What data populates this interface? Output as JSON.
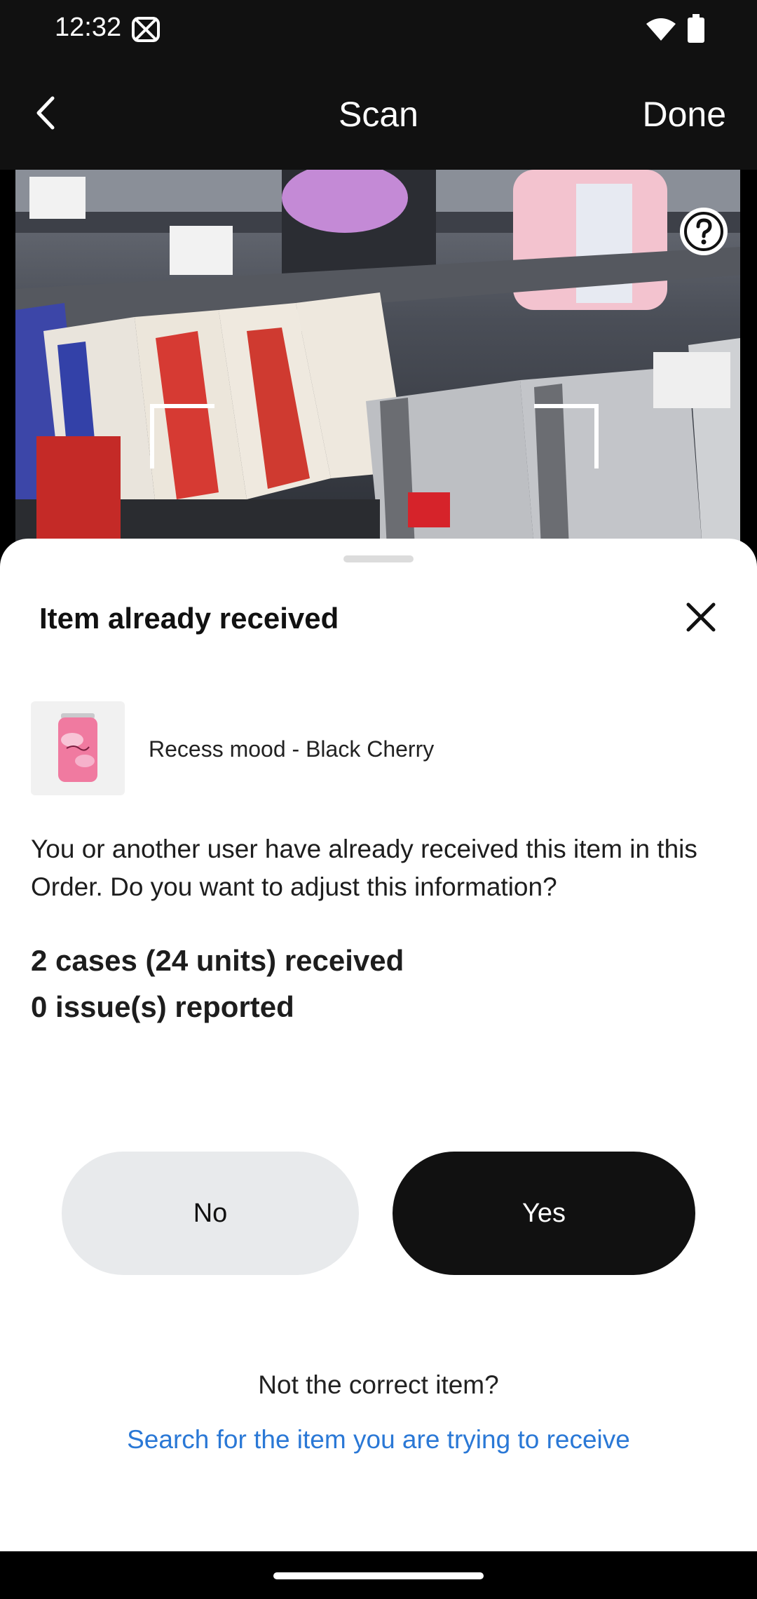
{
  "status_bar": {
    "time": "12:32",
    "icons": [
      "app-notification-icon",
      "wifi-icon",
      "battery-icon"
    ]
  },
  "app_bar": {
    "back_icon": "chevron-left-icon",
    "title": "Scan",
    "done_label": "Done"
  },
  "camera": {
    "help_icon": "question-icon"
  },
  "sheet": {
    "title": "Item already received",
    "close_icon": "close-icon",
    "product": {
      "name": "Recess mood - Black Cherry",
      "thumbnail_icon": "can-icon"
    },
    "message": "You or another user have already received this item in this Order. Do you want to adjust this information?",
    "summary": {
      "received": "2 cases (24 units) received",
      "issues": "0 issue(s) reported"
    },
    "buttons": {
      "no": "No",
      "yes": "Yes"
    },
    "not_correct_text": "Not the correct item?",
    "search_link": "Search for the item you are trying to receive"
  },
  "colors": {
    "link": "#2a78d6",
    "primary_button": "#111111",
    "secondary_button": "#e8eaec"
  }
}
